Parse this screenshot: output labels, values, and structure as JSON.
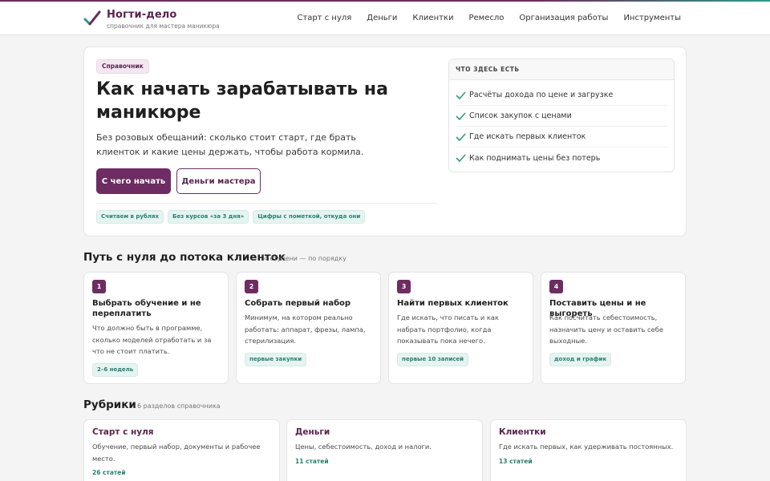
{
  "header": {
    "logo_title": "Ногти-дело",
    "logo_subtitle": "справочник для мастера маникюра",
    "nav": [
      "Старт с нуля",
      "Деньги",
      "Клиентки",
      "Ремесло",
      "Организация работы",
      "Инструменты"
    ]
  },
  "hero": {
    "badge": "Справочник",
    "title": "Как начать зарабатывать на маникюре",
    "lead": "Без розовых обещаний: сколько стоит старт, где брать клиенток и какие цены держать, чтобы работа кормила.",
    "primary_button": "С чего начать",
    "secondary_button": "Деньги мастера",
    "chips": [
      "Считаем в рублях",
      "Без курсов «за 3 дня»",
      "Цифры с пометкой, откуда они"
    ],
    "whats_inside": {
      "title": "ЧТО ЗДЕСЬ ЕСТЬ",
      "items": [
        "Расчёты дохода по цене и загрузке",
        "Список закупок с ценами",
        "Где искать первых клиенток",
        "Как поднимать цены без потерь"
      ]
    }
  },
  "path": {
    "title": "Путь с нуля до потока клиенток",
    "note": "4 ступени — по порядку",
    "steps": [
      {
        "num": "1",
        "title": "Выбрать обучение и не переплатить",
        "text": "Что должно быть в программе, сколько моделей отработать и за что не стоит платить.",
        "tag": "2–6 недель"
      },
      {
        "num": "2",
        "title": "Собрать первый набор",
        "text": "Минимум, на котором реально работать: аппарат, фрезы, лампа, стерилизация.",
        "tag": "первые закупки"
      },
      {
        "num": "3",
        "title": "Найти первых клиенток",
        "text": "Где искать, что писать и как набрать портфолио, когда показывать пока нечего.",
        "tag": "первые 10 записей"
      },
      {
        "num": "4",
        "title": "Поставить цены и не выгореть",
        "text": "Как посчитать себестоимость, назначить цену и оставить себе выходные.",
        "tag": "доход и график"
      }
    ]
  },
  "rubrics": {
    "title": "Рубрики",
    "note": "6 разделов справочника",
    "items": [
      {
        "title": "Старт с нуля",
        "text": "Обучение, первый набор, документы и рабочее место.",
        "count": "26 статей"
      },
      {
        "title": "Деньги",
        "text": "Цены, себестоимость, доход и налоги.",
        "count": "11 статей"
      },
      {
        "title": "Клиентки",
        "text": "Где искать первых, как удерживать постоянных.",
        "count": "13 статей"
      }
    ]
  },
  "colors": {
    "accent": "#6d2c62",
    "teal": "#2a7f70",
    "check": "#2e9a86"
  },
  "icons": {
    "logo": "checkmark-logo-icon",
    "list": "check-icon"
  }
}
